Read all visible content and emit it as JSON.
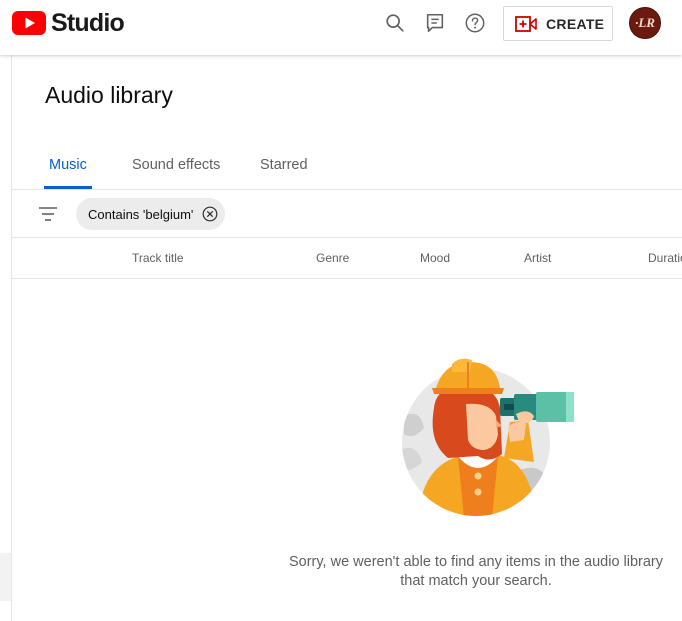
{
  "app": {
    "logo_text": "Studio",
    "logo_icon": "youtube-play-icon",
    "brand_color": "#ff0000"
  },
  "header": {
    "icons": [
      "search-icon",
      "feedback-icon",
      "help-icon"
    ],
    "create_label": "CREATE",
    "create_icon": "create-video-icon",
    "avatar_initials": "·LR"
  },
  "page": {
    "title": "Audio library"
  },
  "tabs": [
    {
      "label": "Music",
      "active": true
    },
    {
      "label": "Sound effects",
      "active": false
    },
    {
      "label": "Starred",
      "active": false
    }
  ],
  "filter": {
    "icon": "filter-icon",
    "chip_label": "Contains 'belgium'",
    "chip_close_icon": "close-circle-icon"
  },
  "table": {
    "columns": [
      "Track title",
      "Genre",
      "Mood",
      "Artist",
      "Duration"
    ]
  },
  "empty_state": {
    "illustration": "searcher-with-binoculars-illustration",
    "message": "Sorry, we weren't able to find any items in the audio library that match your search."
  },
  "colors": {
    "accent": "#065fd4",
    "text_secondary": "#606060",
    "divider": "#e5e5e5"
  }
}
